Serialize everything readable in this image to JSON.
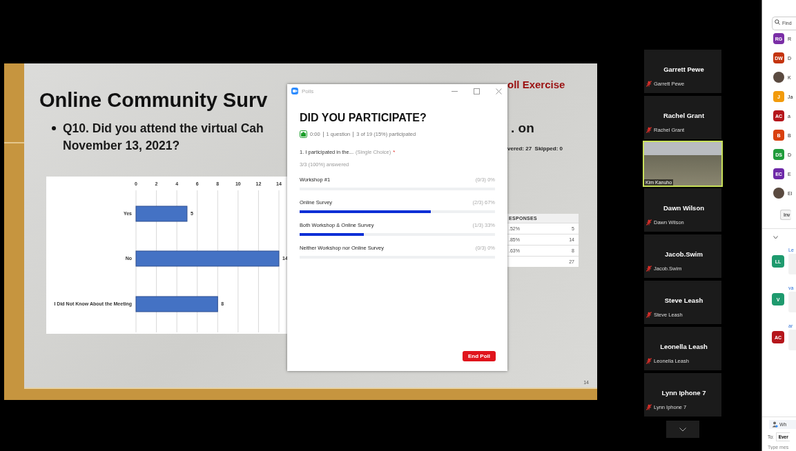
{
  "slide": {
    "title": "Online Community Surv",
    "bullet": "Q10. Did you attend the virtual Cah",
    "bullet_cont": "November 13, 2021?",
    "tag": "oll Exercise",
    "bullet_right": ". on",
    "summary": "vered: 27  Skipped: 0",
    "chart_data": {
      "type": "bar",
      "orientation": "horizontal",
      "categories": [
        "Yes",
        "No",
        "I Did Not Know About the Meeting"
      ],
      "series": [
        {
          "color": "#4472c4",
          "values": [
            5,
            14,
            8
          ]
        }
      ],
      "xlim": [
        0,
        14
      ],
      "xticks": [
        0,
        2,
        4,
        6,
        8,
        10,
        12,
        14
      ],
      "grid": true,
      "data_labels": true
    },
    "table": {
      "header": "ESPONSES",
      "rows": [
        {
          "percent": ".52%",
          "count": "5"
        },
        {
          "percent": ".85%",
          "count": "14"
        },
        {
          "percent": ".63%",
          "count": "8"
        },
        {
          "count": "27"
        }
      ]
    },
    "page_number": "14"
  },
  "poll": {
    "window_title": "Polls",
    "heading": "DID YOU PARTICIPATE?",
    "elapsed": "0:00",
    "questions": "1 question",
    "participation": "3 of 19 (15%) participated",
    "question": "1. I participated in the...",
    "question_type": "(Single Choice)",
    "required_mark": "*",
    "answered": "3/3 (100%) answered",
    "options": [
      {
        "label": "Workshop #1",
        "result": "(0/3) 0%",
        "level": 0
      },
      {
        "label": "Online Survey",
        "result": "(2/3) 67%",
        "level": 0.67
      },
      {
        "label": "Both Workshop & Online Survey",
        "result": "(1/3) 33%",
        "level": 0.33
      },
      {
        "label": "Neither Workshop nor Online Survey",
        "result": "(0/3) 0%",
        "level": 0
      }
    ],
    "end_button": "End Poll"
  },
  "gallery": {
    "tiles": [
      {
        "kind": "name",
        "name": "Garrett Pewe",
        "label": "Garrett Pewe",
        "muted": true
      },
      {
        "kind": "name",
        "name": "Rachel Grant",
        "label": "Rachel Grant",
        "muted": true
      },
      {
        "kind": "video",
        "label": "Kim Kanuho"
      },
      {
        "kind": "name",
        "name": "Dawn Wilson",
        "label": "Dawn Wilson",
        "muted": true
      },
      {
        "kind": "name",
        "name": "Jacob.Swim",
        "label": "Jacob.Swim",
        "muted": true
      },
      {
        "kind": "name",
        "name": "Steve Leash",
        "label": "Steve Leash",
        "muted": true
      },
      {
        "kind": "name",
        "name": "Leonella Leash",
        "label": "Leonella Leash",
        "muted": true
      },
      {
        "kind": "name",
        "name": "Lynn Iphone 7",
        "label": "Lynn Iphone 7",
        "muted": true
      }
    ]
  },
  "panel": {
    "search_placeholder": "Find",
    "participants": [
      {
        "kind": "initials",
        "initials": "RG",
        "color": "#7a2ea6",
        "name": "R"
      },
      {
        "kind": "initials",
        "initials": "DW",
        "color": "#c4340e",
        "name": "D"
      },
      {
        "kind": "photo",
        "name": "K"
      },
      {
        "kind": "initials",
        "initials": "J",
        "color": "#f29b0c",
        "name": "Ja"
      },
      {
        "kind": "initials",
        "initials": "AC",
        "color": "#b5161b",
        "name": "a"
      },
      {
        "kind": "initials",
        "initials": "B",
        "color": "#d9400e",
        "name": "B"
      },
      {
        "kind": "initials",
        "initials": "DS",
        "color": "#1f9b3a",
        "name": "D"
      },
      {
        "kind": "initials",
        "initials": "EC",
        "color": "#6e29a8",
        "name": "E"
      },
      {
        "kind": "photo",
        "name": "El"
      }
    ],
    "invite": "Inv",
    "chat": [
      {
        "initials": "LL",
        "color": "#1e9a6e",
        "name": "Le"
      },
      {
        "initials": "V",
        "color": "#1e9a6e",
        "name": "va"
      },
      {
        "initials": "AC",
        "color": "#b5161b",
        "name": "ar"
      }
    ],
    "who_can_see": "Wh",
    "to_label": "To:",
    "to_value": "Ever",
    "input_placeholder": "Type mes"
  }
}
